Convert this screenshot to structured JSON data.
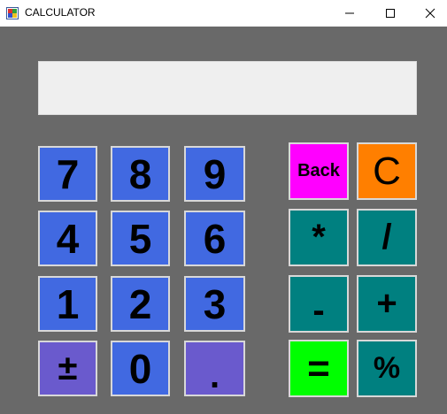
{
  "window": {
    "title": "CALCULATOR"
  },
  "display": {
    "value": ""
  },
  "keys": {
    "seven": "7",
    "eight": "8",
    "nine": "9",
    "four": "4",
    "five": "5",
    "six": "6",
    "one": "1",
    "two": "2",
    "three": "3",
    "plus_minus": "±",
    "zero": "0",
    "decimal": ".",
    "back": "Back",
    "clear": "C",
    "multiply": "*",
    "divide": "/",
    "subtract": "-",
    "add": "+",
    "equals": "=",
    "percent": "%"
  },
  "colors": {
    "background": "#696969",
    "number_key": "#4169e1",
    "purple_key": "#6a5acd",
    "operator_key": "#008080",
    "back_key": "#ff00ff",
    "clear_key": "#ff7f00",
    "equals_key": "#00ff00",
    "display": "#efefef"
  }
}
